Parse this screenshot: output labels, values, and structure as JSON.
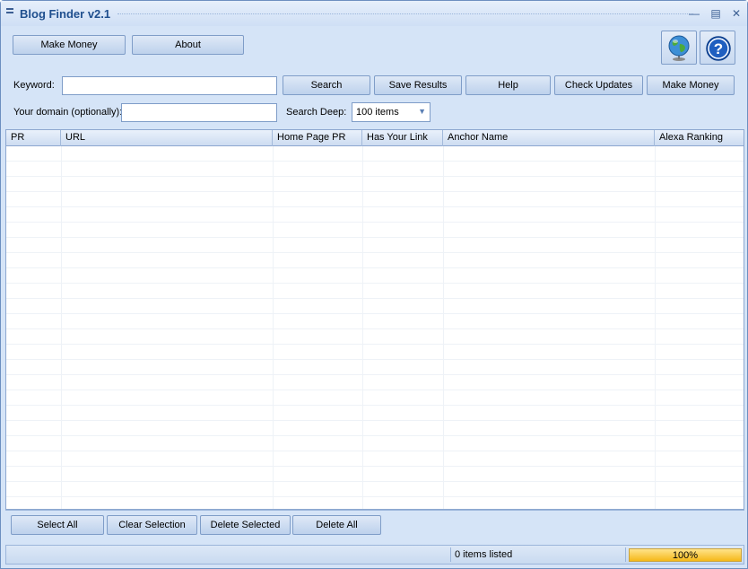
{
  "window": {
    "title": "Blog Finder v2.1"
  },
  "toolbar": {
    "make_money": "Make Money",
    "about": "About"
  },
  "icons": {
    "globe": "globe-icon",
    "help": "help-icon"
  },
  "search": {
    "keyword_label": "Keyword:",
    "keyword_value": "",
    "domain_label": "Your domain (optionally):",
    "domain_value": "",
    "deep_label": "Search Deep:",
    "deep_value": "100 items",
    "buttons": {
      "search": "Search",
      "save_results": "Save Results",
      "help": "Help",
      "check_updates": "Check Updates",
      "make_money": "Make Money"
    }
  },
  "table": {
    "columns": [
      "PR",
      "URL",
      "Home Page PR",
      "Has Your Link",
      "Anchor Name",
      "Alexa Ranking"
    ],
    "rows": []
  },
  "actions": {
    "select_all": "Select All",
    "clear_selection": "Clear Selection",
    "delete_selected": "Delete Selected",
    "delete_all": "Delete All"
  },
  "status": {
    "items_listed": "0 items listed",
    "progress_text": "100%",
    "progress": 1.0
  }
}
